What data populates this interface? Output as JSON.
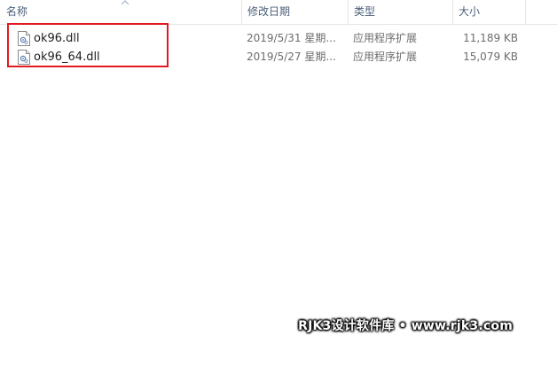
{
  "columns": {
    "name": "名称",
    "date_modified": "修改日期",
    "type": "类型",
    "size": "大小"
  },
  "files": [
    {
      "name": "ok96.dll",
      "date": "2019/5/31 星期...",
      "type": "应用程序扩展",
      "size": "11,189 KB",
      "icon": "dll-file-icon"
    },
    {
      "name": "ok96_64.dll",
      "date": "2019/5/27 星期...",
      "type": "应用程序扩展",
      "size": "15,079 KB",
      "icon": "dll-file-icon"
    }
  ],
  "watermark": "RJK3设计软件库 • www.rjk3.com",
  "colors": {
    "highlight": "#e11a22",
    "header_text": "#4c607a",
    "secondary_text": "#6d6d6d"
  }
}
